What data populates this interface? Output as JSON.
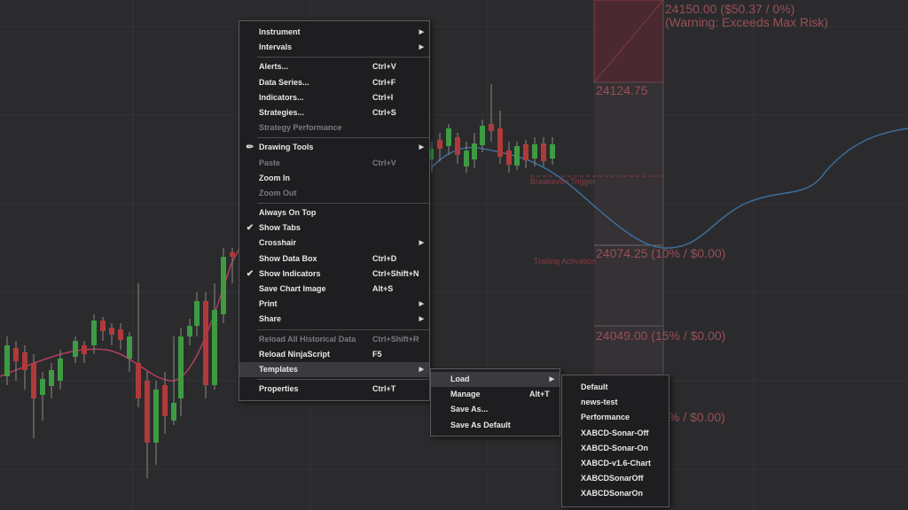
{
  "colors": {
    "background": "#2b2b2d",
    "up_candle": "#3e9b43",
    "down_candle": "#b03a3a",
    "moving_average_1": "#b33e5a",
    "moving_average_2": "#3d6e9e",
    "risk_zone": "#8a3a44"
  },
  "risk_labels": {
    "stop_price": "24150.00  ($50.37 / 0%)",
    "warning": "(Warning: Exceeds Max Risk)",
    "entry_price": "24124.75",
    "target1": "24074.25 (10% / $0.00)",
    "target2": "24049.00 (15% / $0.00)",
    "target3_partial": "% / $0.00)",
    "breakeven_trigger": "Breakeven Trigger",
    "trailing_activation": "Trailing Activation"
  },
  "context_menu": {
    "instrument": "Instrument",
    "intervals": "Intervals",
    "alerts": "Alerts...",
    "alerts_sc": "Ctrl+V",
    "data_series": "Data Series...",
    "data_series_sc": "Ctrl+F",
    "indicators": "Indicators...",
    "indicators_sc": "Ctrl+I",
    "strategies": "Strategies...",
    "strategies_sc": "Ctrl+S",
    "strategy_performance": "Strategy Performance",
    "drawing_tools": "Drawing Tools",
    "paste": "Paste",
    "paste_sc": "Ctrl+V",
    "zoom_in": "Zoom In",
    "zoom_out": "Zoom Out",
    "always_on_top": "Always On Top",
    "show_tabs": "Show Tabs",
    "crosshair": "Crosshair",
    "show_data_box": "Show Data Box",
    "show_data_box_sc": "Ctrl+D",
    "show_indicators": "Show Indicators",
    "show_indicators_sc": "Ctrl+Shift+N",
    "save_chart_image": "Save Chart Image",
    "save_chart_image_sc": "Alt+S",
    "print": "Print",
    "share": "Share",
    "reload_historical": "Reload All Historical Data",
    "reload_historical_sc": "Ctrl+Shift+R",
    "reload_ninjascript": "Reload NinjaScript",
    "reload_ninjascript_sc": "F5",
    "templates": "Templates",
    "properties": "Properties",
    "properties_sc": "Ctrl+T"
  },
  "templates_menu": {
    "load": "Load",
    "manage": "Manage",
    "manage_sc": "Alt+T",
    "save_as": "Save As...",
    "save_as_default": "Save As Default"
  },
  "load_menu": {
    "items": [
      "Default",
      "news-test",
      "Performance",
      "XABCD-Sonar-Off",
      "XABCD-Sonar-On",
      "XABCD-v1.6-Chart",
      "XABCDSonarOff",
      "XABCDSonarOn"
    ]
  },
  "icons": {
    "submenu_arrow": "▶",
    "checkmark": "✔",
    "pencil": "✏"
  }
}
